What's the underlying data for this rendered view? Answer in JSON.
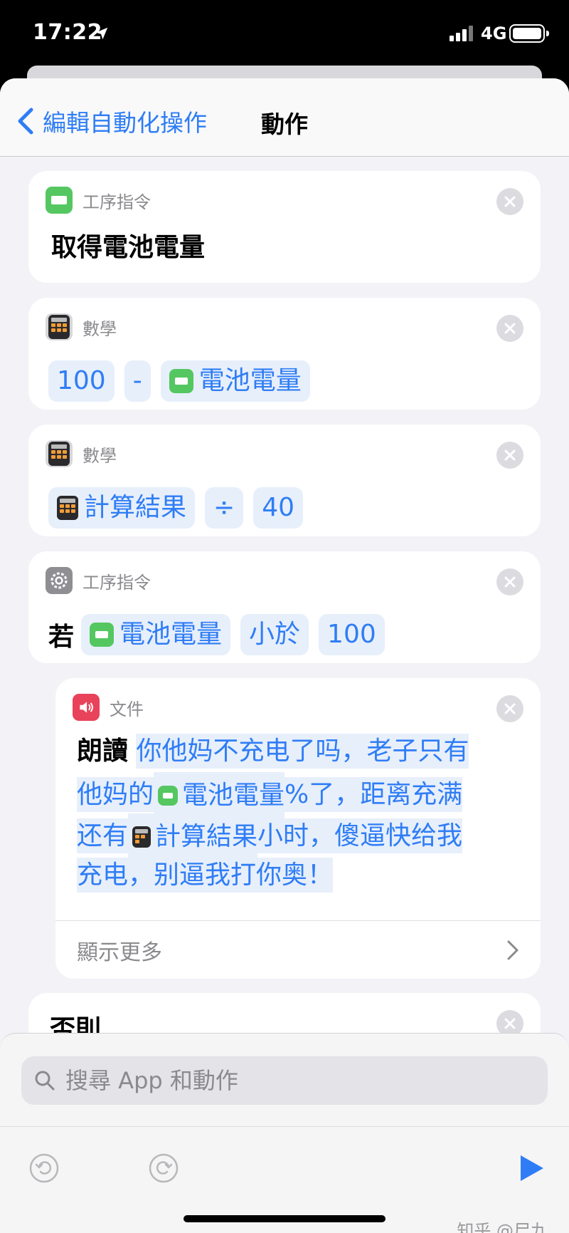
{
  "status": {
    "time": "17:22",
    "network": "4G",
    "icons": [
      "location-arrow-icon",
      "signal-bars-icon",
      "battery-icon"
    ]
  },
  "navbar": {
    "back_label": "編輯自動化操作",
    "title": "動作"
  },
  "actions": [
    {
      "category": "工序指令",
      "icon": "battery-icon",
      "icon_color": "#54c761",
      "title": "取得電池電量"
    },
    {
      "category": "數學",
      "icon": "calculator-icon",
      "tokens": [
        "100",
        "-",
        "電池電量"
      ]
    },
    {
      "category": "數學",
      "icon": "calculator-icon",
      "tokens": [
        "計算結果",
        "÷",
        "40"
      ]
    },
    {
      "category": "工序指令",
      "icon": "gear-icon",
      "keyword": "若",
      "tokens": [
        "電池電量",
        "小於",
        "100"
      ]
    },
    {
      "category": "文件",
      "icon": "speaker-icon",
      "icon_color": "#e8435a",
      "keyword": "朗讀",
      "text_parts": [
        "你他妈不充电了吗，老子只有",
        "他妈的",
        "電池電量",
        "%了，距离充满",
        "还有",
        "計算結果",
        "小时，傻逼快给我",
        "充电，别逼我打你奥！"
      ],
      "show_more": "顯示更多"
    },
    {
      "keyword": "否則"
    }
  ],
  "search": {
    "placeholder": "搜尋 App 和動作"
  },
  "toolbar": {
    "icons": [
      "undo-icon",
      "redo-icon",
      "play-icon"
    ],
    "accent": "#2f7df6"
  },
  "watermark": "知乎 @尸九"
}
